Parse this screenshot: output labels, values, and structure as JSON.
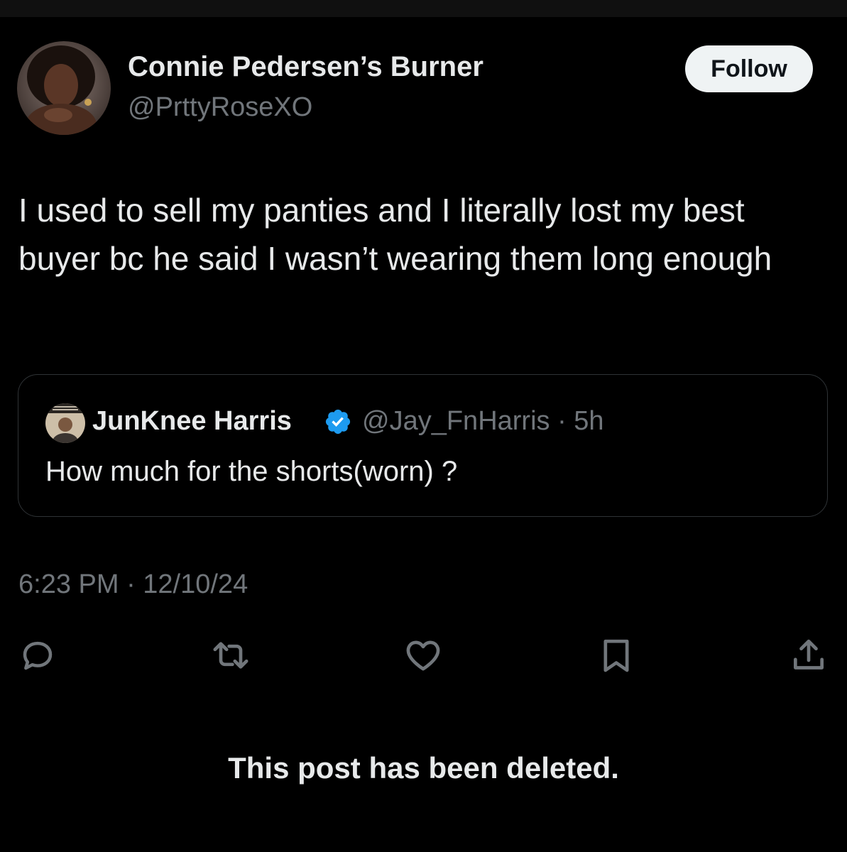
{
  "post": {
    "author": {
      "display_name": "Connie Pedersen’s Burner",
      "handle": "@PrttyRoseXO",
      "avatar_icon": "profile-photo"
    },
    "follow_label": "Follow",
    "text": "I used to sell my panties and I literally lost my best buyer bc he said I wasn’t wearing them long enough",
    "timestamp": "6:23 PM · 12/10/24"
  },
  "quote": {
    "display_name": "JunKnee Harris",
    "verified": true,
    "verified_color": "#1d9bf0",
    "handle": "@Jay_FnHarris",
    "age": "5h",
    "meta": "@Jay_FnHarris · 5h",
    "text": "How much for the shorts(worn) ?"
  },
  "actions": [
    {
      "icon": "reply-icon"
    },
    {
      "icon": "repost-icon"
    },
    {
      "icon": "like-icon"
    },
    {
      "icon": "bookmark-icon"
    },
    {
      "icon": "share-icon"
    }
  ],
  "deleted_notice": "This post has been deleted.",
  "colors": {
    "background": "#000000",
    "primary_text": "#e7e9ea",
    "secondary_text": "#71767b",
    "border": "#2f3336",
    "follow_button_bg": "#eff3f4",
    "icon": "#71767b"
  }
}
